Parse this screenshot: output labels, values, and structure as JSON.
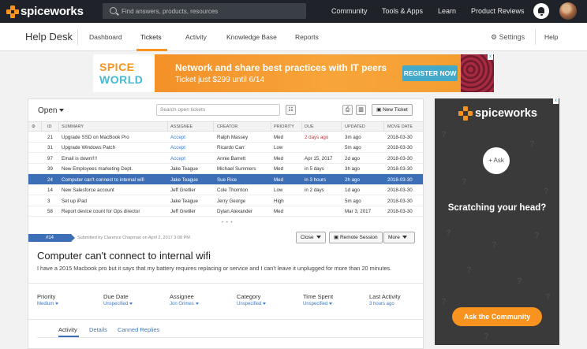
{
  "topbar": {
    "logo_text": "spiceworks",
    "search_placeholder": "Find answers, products, resources",
    "nav": [
      {
        "label": "Community"
      },
      {
        "label": "Tools & Apps"
      },
      {
        "label": "Learn"
      },
      {
        "label": "Product Reviews"
      }
    ]
  },
  "subnav": {
    "title": "Help Desk",
    "tabs": [
      {
        "label": "Dashboard"
      },
      {
        "label": "Tickets"
      },
      {
        "label": "Activity"
      },
      {
        "label": "Knowledge Base"
      },
      {
        "label": "Reports"
      }
    ],
    "settings_label": "Settings",
    "help_label": "Help"
  },
  "banner": {
    "logo_line1": "SPICE",
    "logo_line2": "WORLD",
    "headline": "Network and share best practices with IT peers",
    "subline": "Ticket just $299 until 6/14",
    "cta": "REGISTER NOW",
    "ad_marker": "x"
  },
  "tickets": {
    "filter_label": "Open",
    "search_placeholder": "Search open tickets",
    "new_ticket_label": "New Ticket",
    "columns": [
      "ID",
      "SUMMARY",
      "ASSIGNEE",
      "CREATOR",
      "PRIORITY",
      "DUE",
      "UPDATED",
      "MOVE DATE"
    ],
    "rows": [
      {
        "id": "21",
        "summary": "Upgrade SSD on MacBook Pro",
        "assignee": "Accept",
        "creator": "Ralph Massey",
        "priority": "Med",
        "due": "2 days ago",
        "updated": "3m ago",
        "move": "2018-03-30"
      },
      {
        "id": "31",
        "summary": "Upgrade Windows Patch",
        "assignee": "Accept",
        "creator": "Ricardo Carr",
        "priority": "Low",
        "due": "",
        "updated": "5m ago",
        "move": "2018-03-30"
      },
      {
        "id": "97",
        "summary": "Email is down!!!!",
        "assignee": "Accept",
        "creator": "Annie Barrett",
        "priority": "Med",
        "due": "Apr 15, 2017",
        "updated": "2d ago",
        "move": "2018-03-30"
      },
      {
        "id": "39",
        "summary": "New Employees marketing Dept.",
        "assignee": "Jake Teague",
        "creator": "Michael Summers",
        "priority": "Med",
        "due": "in 5 days",
        "updated": "3h ago",
        "move": "2018-03-30"
      },
      {
        "id": "24",
        "summary": "Computer can't connect to internal wifi",
        "assignee": "Jake Teague",
        "creator": "Sue Rice",
        "priority": "Med",
        "due": "in 3 hours",
        "updated": "2h ago",
        "move": "2018-03-30"
      },
      {
        "id": "14",
        "summary": "New Salesforce account",
        "assignee": "Jeff Gretller",
        "creator": "Cole Thornton",
        "priority": "Low",
        "due": "in 2 days",
        "updated": "1d ago",
        "move": "2018-03-30"
      },
      {
        "id": "3",
        "summary": "Set up iPad",
        "assignee": "Jake Teague",
        "creator": "Jerry George",
        "priority": "High",
        "due": "",
        "updated": "5m ago",
        "move": "2018-03-30"
      },
      {
        "id": "58",
        "summary": "Report device count for Ops director",
        "assignee": "Jeff Gretller",
        "creator": "Dylan Alexander",
        "priority": "Med",
        "due": "",
        "updated": "Mar 3, 2017",
        "move": "2018-03-30"
      }
    ],
    "selected_index": 4,
    "drag_handle": "• • •"
  },
  "detail": {
    "tag": "#14",
    "submitted": "Submitted by Clarence Chapman on April 2, 2017 3:08 PM",
    "close_label": "Close",
    "remote_label": "Remote Session",
    "more_label": "More",
    "title": "Computer can't connect to internal wifi",
    "description": "I have a 2015 Macbook pro but it says that my battery requires replacing or service and I can't leave it unplugged for more than 20 minutes.",
    "props": [
      {
        "label": "Priority",
        "value": "Medium"
      },
      {
        "label": "Due Date",
        "value": "Unspecified"
      },
      {
        "label": "Assignee",
        "value": "Jon Grimes"
      },
      {
        "label": "Category",
        "value": "Unspecified"
      },
      {
        "label": "Time Spent",
        "value": "Unspecified"
      },
      {
        "label": "Last Activity",
        "value": "3 hours ago"
      }
    ],
    "tabs": [
      {
        "label": "Activity"
      },
      {
        "label": "Details"
      },
      {
        "label": "Canned Replies"
      }
    ]
  },
  "side_ad": {
    "logo_text": "spiceworks",
    "ask_circle": "+ Ask",
    "headline": "Scratching your head?",
    "cta": "Ask the Community",
    "ad_marker": "x"
  },
  "colors": {
    "accent_orange": "#f7931e",
    "selection_blue": "#3d6fb6",
    "link_blue": "#3b7bc8",
    "topbar_bg": "#1f2329"
  }
}
